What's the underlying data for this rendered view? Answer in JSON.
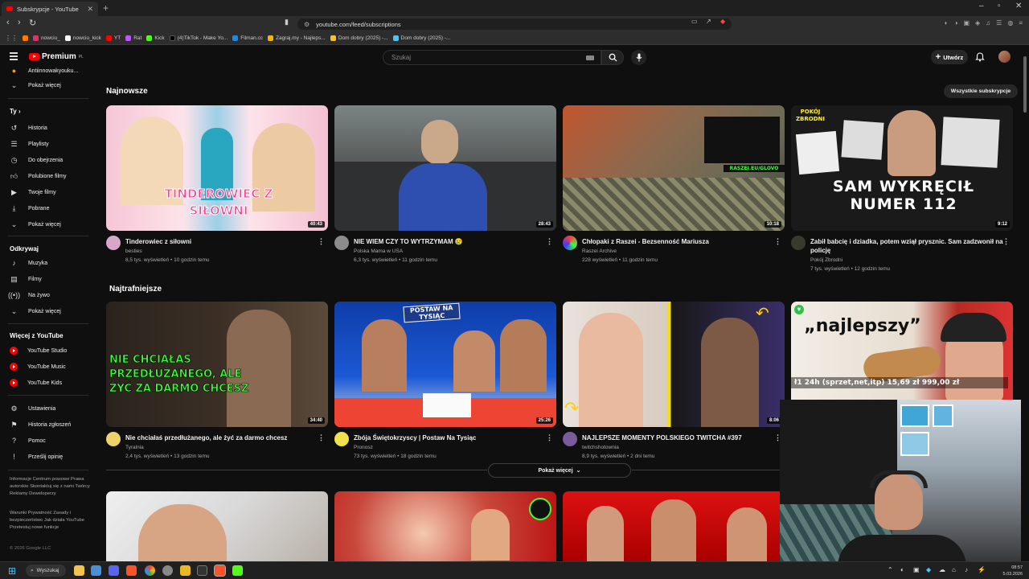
{
  "browser": {
    "tab_title": "Subskrypcje - YouTube",
    "new_tab": "+",
    "url": "youtube.com/feed/subscriptions",
    "bookmarks": [
      "nowciu_",
      "nowciu_kick",
      "YT",
      "Rat",
      "Kick",
      "(4)TikTok - Make Yo...",
      "Filman.cc",
      "Zagraj.my - Najleps...",
      "Dom dobry (2025) -...",
      "Dom dobry (2025) -..."
    ]
  },
  "header": {
    "logo": "Premium",
    "region": "PL",
    "search_placeholder": "Szukaj",
    "create_label": "Utwórz"
  },
  "sidebar": {
    "top_partial": "Antiinnowakyouku...",
    "show_more_1": "Pokaż więcej",
    "you_heading": "Ty",
    "you_items": [
      "Historia",
      "Playlisty",
      "Do obejrzenia",
      "Polubione filmy",
      "Twoje filmy",
      "Pobrane",
      "Pokaż więcej"
    ],
    "explore_heading": "Odkrywaj",
    "explore_items": [
      "Muzyka",
      "Filmy",
      "Na żywo",
      "Pokaż więcej"
    ],
    "more_heading": "Więcej z YouTube",
    "more_items": [
      "YouTube Studio",
      "YouTube Music",
      "YouTube Kids"
    ],
    "settings_items": [
      "Ustawienia",
      "Historia zgłoszeń",
      "Pomoc",
      "Prześlij opinię"
    ],
    "footer_1": "Informacje  Centrum prasowe  Prawa autorskie  Skontaktuj się z nami  Twórcy  Reklamy  Deweloperzy",
    "footer_2": "Warunki  Prywatność  Zasady i bezpieczeństwo  Jak działa YouTube  Przetestuj nowe funkcje",
    "copyright": "© 2026 Google LLC"
  },
  "main": {
    "section1_title": "Najnowsze",
    "all_subs": "Wszystkie subskrypcje",
    "section2_title": "Najtrafniejsze",
    "show_more": "Pokaż więcej",
    "videos_row1": [
      {
        "title": "Tinderowiec z siłowni",
        "channel": "besties",
        "stats": "8,5 tys. wyświetleń • 10 godzin temu",
        "duration": "40:43",
        "thumb_text": "TINDEROWIEC Z SIŁOWNI"
      },
      {
        "title": "NIE WIEM CZY TO WYTRZYMAM 😢",
        "channel": "Polska Mama w USA",
        "stats": "6,3 tys. wyświetleń • 11 godzin temu",
        "duration": "28:43"
      },
      {
        "title": "Chłopaki z Raszei - Bezsenność Mariusza",
        "channel": "Raszei Archive",
        "stats": "228 wyświetleń • 11 godzin temu",
        "duration": "10:18",
        "thumb_text": "RASZEI.EU/GLOVO"
      },
      {
        "title": "Zabił babcię i dziadka, potem wziął prysznic. Sam zadzwonił na policję",
        "channel": "Pokój Zbrodni",
        "stats": "7 tys. wyświetleń • 12 godzin temu",
        "duration": "9:12",
        "thumb_text": "SAM WYKRĘCIŁ NUMER 112",
        "thumb_label": "POKÓJ ZBRODNI"
      }
    ],
    "videos_row2": [
      {
        "title": "Nie chciałaś przedłużanego, ale żyć za darmo chcesz",
        "channel": "Tyralnia",
        "stats": "2,4 tys. wyświetleń • 13 godzin temu",
        "duration": "34:40",
        "thumb_text": "NIE CHCIAŁAŚ PRZEDŁUŻANEGO, ALE ŻYĆ ZA DARMO CHCESZ"
      },
      {
        "title": "Zbója Świętokrzyscy | Postaw Na Tysiąc",
        "channel": "Pronosz",
        "stats": "73 tys. wyświetleń • 18 godzin temu",
        "duration": "25:26",
        "thumb_text": "POSTAW NA TYSIĄC"
      },
      {
        "title": "NAJLEPSZE MOMENTY POLSKIEGO TWITCHA #397",
        "channel": "twitchshotownia",
        "stats": "8,9 tys. wyświetleń • 2 dni temu",
        "duration": "8:06"
      },
      {
        "title": "",
        "channel": "",
        "stats": "",
        "duration": "",
        "thumb_text": "„najlepszy”",
        "thumb_sub": "ł1 24h (sprzet,net,itp)   15,69 zł   999,00 zł"
      }
    ]
  },
  "taskbar": {
    "search": "Wyszukaj",
    "time": "08:57",
    "date": "5.03.2026"
  },
  "colors": {
    "background": "#0f0f0f",
    "accent_red": "#ff0000",
    "green_text": "#3bff3b",
    "yellow_text": "#ffef2a"
  }
}
